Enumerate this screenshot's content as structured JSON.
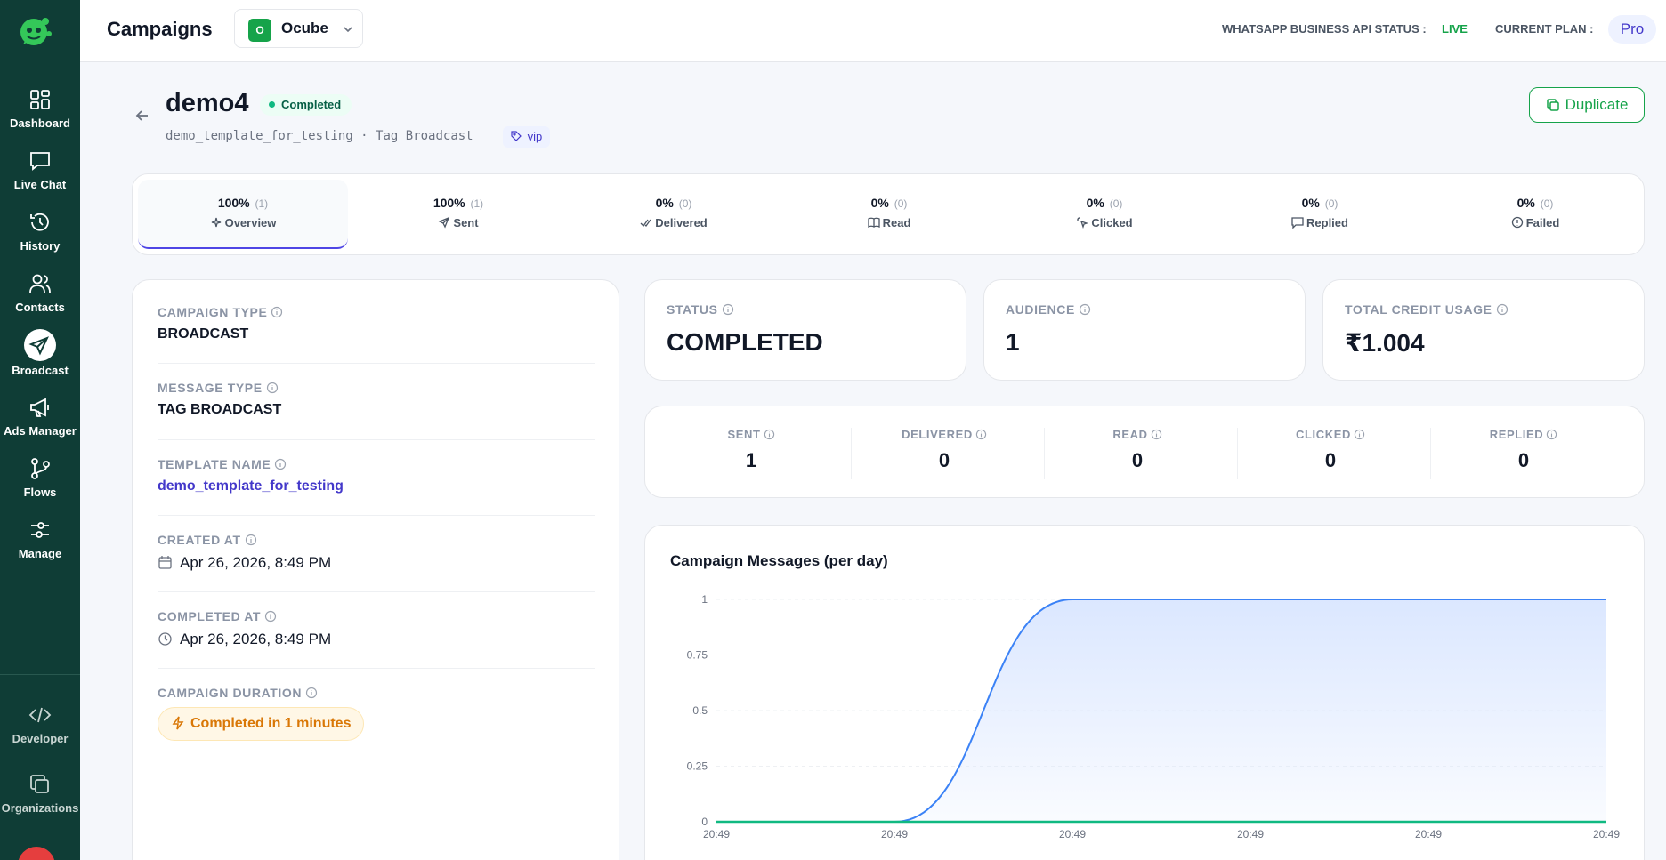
{
  "sidebar": {
    "items": [
      {
        "label": "Dashboard",
        "icon": "grid-icon"
      },
      {
        "label": "Live Chat",
        "icon": "chat-icon"
      },
      {
        "label": "History",
        "icon": "history-icon"
      },
      {
        "label": "Contacts",
        "icon": "users-icon"
      },
      {
        "label": "Broadcast",
        "icon": "send-icon"
      },
      {
        "label": "Ads Manager",
        "icon": "megaphone-icon"
      },
      {
        "label": "Flows",
        "icon": "flow-icon"
      },
      {
        "label": "Manage",
        "icon": "sliders-icon"
      }
    ],
    "bottom": [
      {
        "label": "Developer",
        "icon": "code-icon"
      },
      {
        "label": "Organizations",
        "icon": "copy-icon"
      }
    ],
    "active": "Broadcast"
  },
  "topbar": {
    "title": "Campaigns",
    "org": {
      "badge": "O",
      "name": "Ocube"
    },
    "api_status_label": "WHATSAPP BUSINESS API STATUS :",
    "api_status_value": "LIVE",
    "plan_label": "CURRENT PLAN :",
    "plan_value": "Pro"
  },
  "campaign": {
    "name": "demo4",
    "status": "Completed",
    "template": "demo_template_for_testing",
    "separator": "·",
    "type_text": "Tag Broadcast",
    "tag": "vip",
    "duplicate_label": "Duplicate"
  },
  "tabs": [
    {
      "pct": "100%",
      "count": "(1)",
      "label": "Overview",
      "icon": "sparkle-icon"
    },
    {
      "pct": "100%",
      "count": "(1)",
      "label": "Sent",
      "icon": "send-icon"
    },
    {
      "pct": "0%",
      "count": "(0)",
      "label": "Delivered",
      "icon": "double-check-icon"
    },
    {
      "pct": "0%",
      "count": "(0)",
      "label": "Read",
      "icon": "book-icon"
    },
    {
      "pct": "0%",
      "count": "(0)",
      "label": "Clicked",
      "icon": "click-icon"
    },
    {
      "pct": "0%",
      "count": "(0)",
      "label": "Replied",
      "icon": "message-icon"
    },
    {
      "pct": "0%",
      "count": "(0)",
      "label": "Failed",
      "icon": "alert-icon"
    }
  ],
  "details": {
    "campaign_type_label": "CAMPAIGN TYPE",
    "campaign_type": "BROADCAST",
    "message_type_label": "MESSAGE TYPE",
    "message_type": "TAG BROADCAST",
    "template_name_label": "TEMPLATE NAME",
    "template_name": "demo_template_for_testing",
    "created_at_label": "CREATED AT",
    "created_at": "Apr 26, 2026, 8:49 PM",
    "completed_at_label": "COMPLETED AT",
    "completed_at": "Apr 26, 2026, 8:49 PM",
    "duration_label": "CAMPAIGN DURATION",
    "duration": "Completed in 1 minutes"
  },
  "stats": {
    "status_label": "STATUS",
    "status": "COMPLETED",
    "audience_label": "AUDIENCE",
    "audience": "1",
    "credit_label": "TOTAL CREDIT USAGE",
    "credit": "₹1.004"
  },
  "funnel": [
    {
      "label": "SENT",
      "value": "1"
    },
    {
      "label": "DELIVERED",
      "value": "0"
    },
    {
      "label": "READ",
      "value": "0"
    },
    {
      "label": "CLICKED",
      "value": "0"
    },
    {
      "label": "REPLIED",
      "value": "0"
    }
  ],
  "chart": {
    "title": "Campaign Messages (per day)"
  },
  "chart_data": {
    "type": "area",
    "title": "Campaign Messages (per day)",
    "x": [
      "20:49",
      "20:49",
      "20:49",
      "20:49",
      "20:49",
      "20:49"
    ],
    "y_ticks": [
      "0",
      "0.25",
      "0.5",
      "0.75",
      "1"
    ],
    "ylim": [
      0,
      1
    ],
    "grid": true,
    "colors": {
      "area_line": "#3b82f6",
      "area_fill": "#dbe7ff",
      "flat_line": "#10b981"
    },
    "series": [
      {
        "values": [
          0,
          0,
          1,
          1,
          1,
          1
        ]
      },
      {
        "values": [
          0,
          0,
          0,
          0,
          0,
          0
        ]
      }
    ]
  }
}
